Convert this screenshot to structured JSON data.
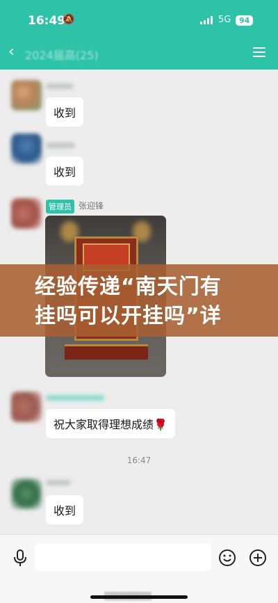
{
  "status_bar": {
    "time": "16:49",
    "network": "5G",
    "battery": "94"
  },
  "nav": {
    "title": "2024届高(25)"
  },
  "messages": [
    {
      "text": "收到"
    },
    {
      "text": "收到"
    },
    {
      "role_badge": "管理员",
      "sender": "张迎锋"
    },
    {
      "text": "祝大家取得理想成绩🌹"
    },
    {
      "text": "收到"
    }
  ],
  "timestamp": "16:47",
  "overlay_banner": {
    "line1": "经验传递“南天门有",
    "line2": "挂吗可以开挂吗”详"
  },
  "icons": {
    "mute": "bell-slash-icon",
    "back": "chevron-left-icon",
    "menu": "hamburger-menu-icon",
    "voice": "microphone-icon",
    "emoji": "emoji-icon",
    "more": "plus-circle-icon"
  },
  "colors": {
    "header": "#2ec3a8",
    "banner": "#a86032",
    "background": "#ededed"
  }
}
